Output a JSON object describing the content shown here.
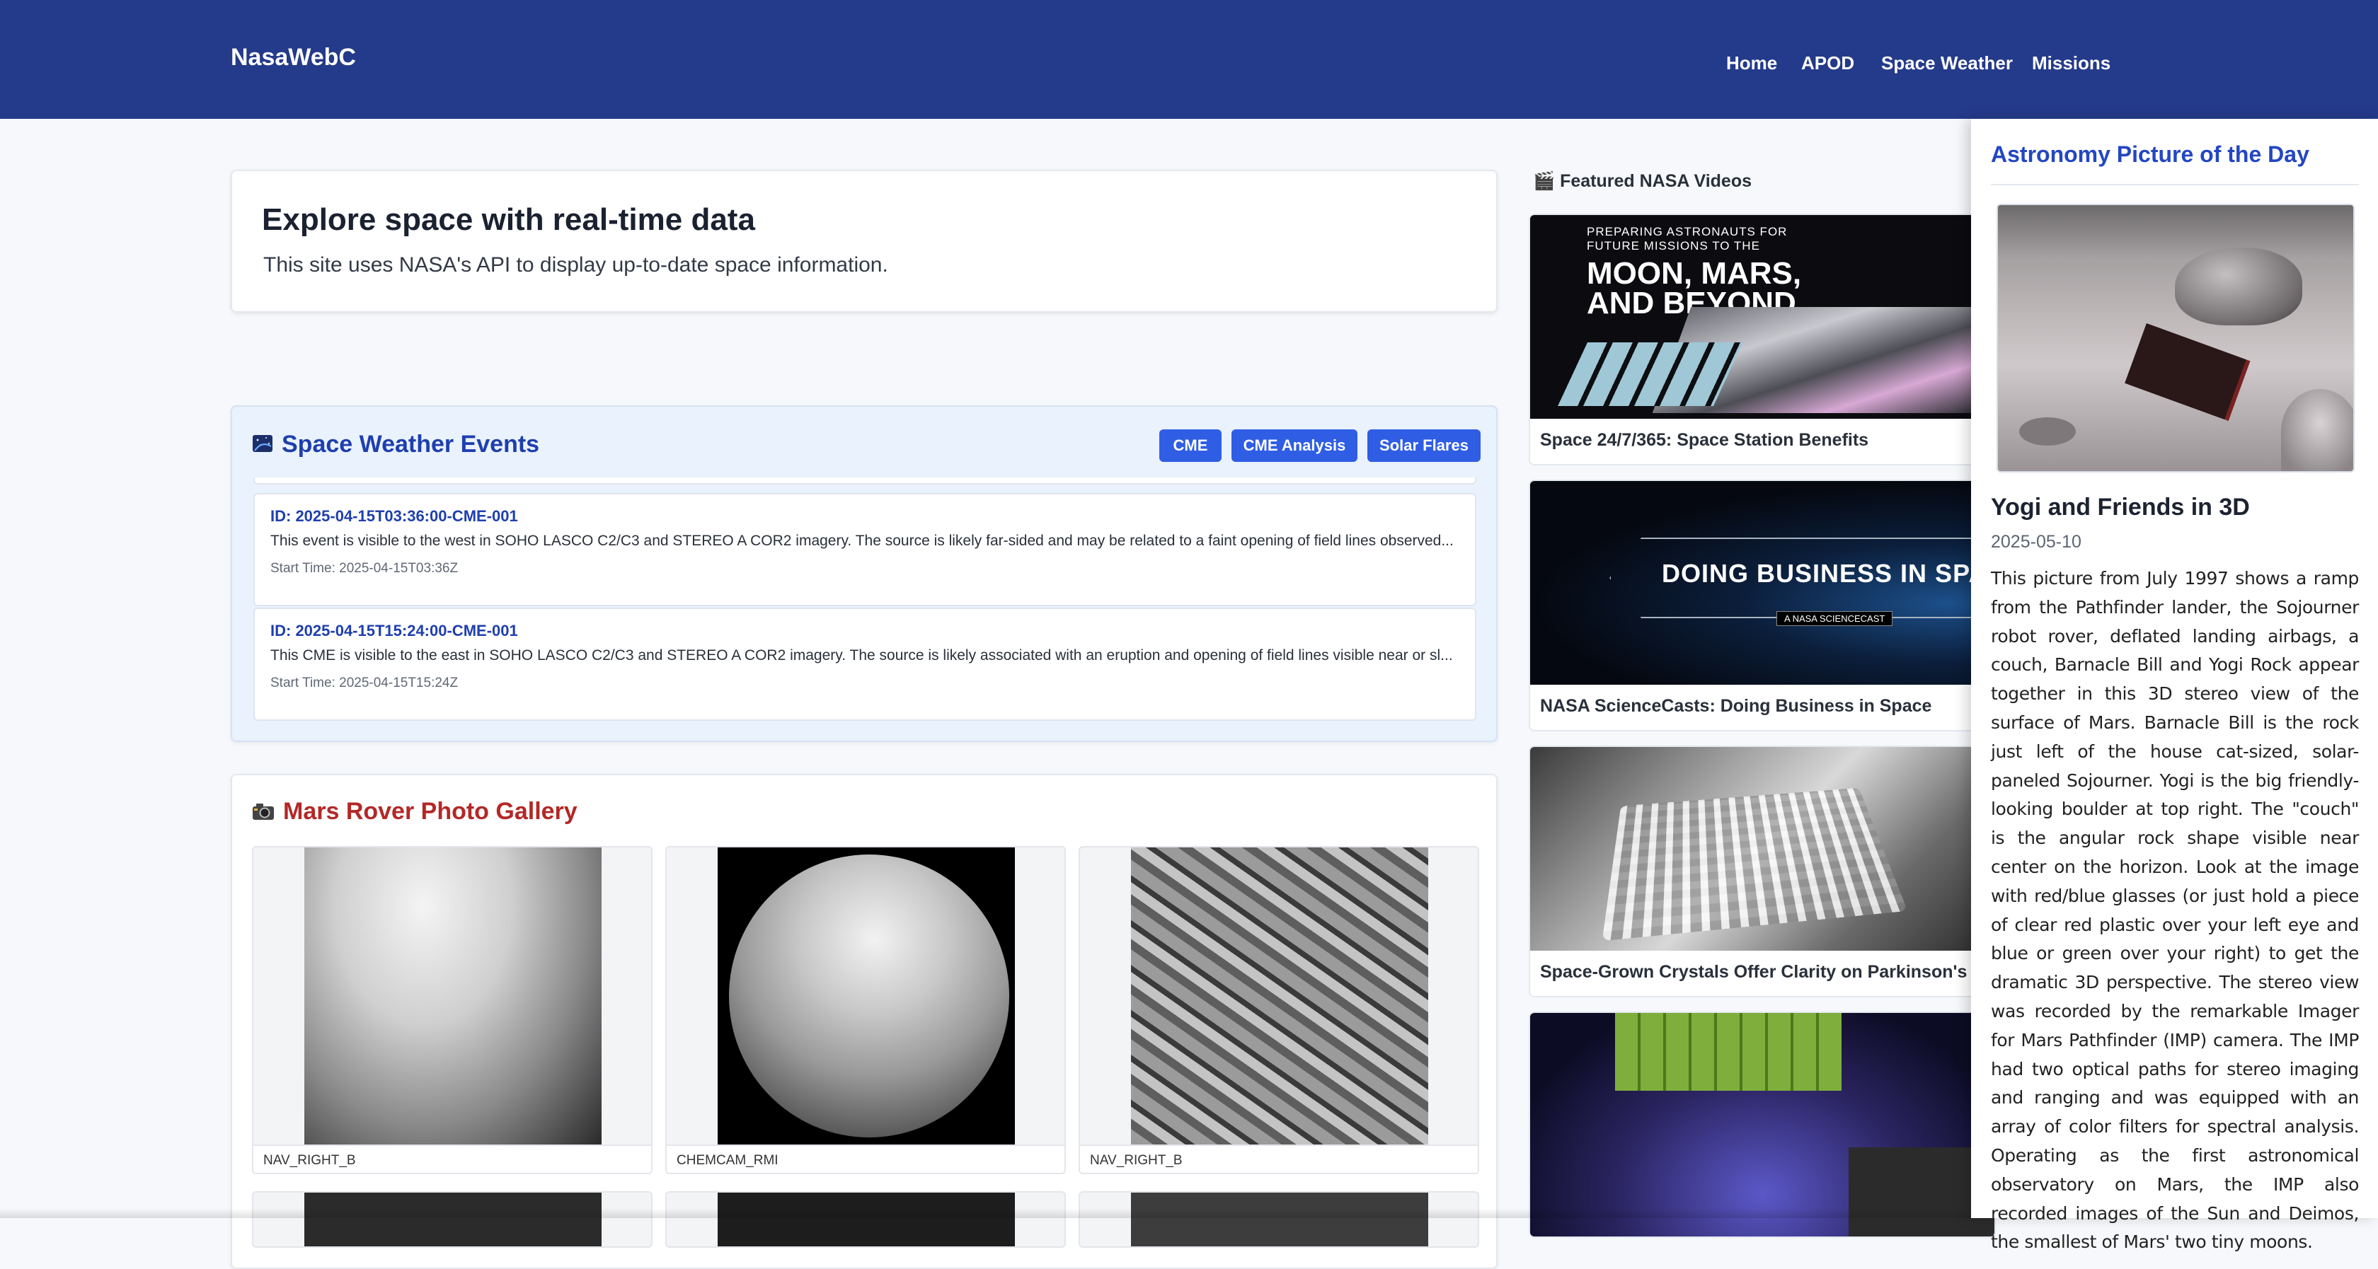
{
  "header": {
    "brand": "NasaWebC",
    "nav": [
      "Home",
      "APOD",
      "Space Weather",
      "Missions"
    ]
  },
  "intro": {
    "title": "Explore space with real-time data",
    "subtitle": "This site uses NASA's API to display up-to-date space information."
  },
  "weather": {
    "title": "Space Weather Events",
    "buttons": [
      "CME",
      "CME Analysis",
      "Solar Flares"
    ],
    "events": [
      {
        "id": "ID: 2025-04-15T03:36:00-CME-001",
        "description": "This event is visible to the west in SOHO LASCO C2/C3 and STEREO A COR2 imagery. The source is likely far-sided and may be related to a faint opening of field lines observed...",
        "start": "Start Time: 2025-04-15T03:36Z"
      },
      {
        "id": "ID: 2025-04-15T15:24:00-CME-001",
        "description": "This CME is visible to the east in SOHO LASCO C2/C3 and STEREO A COR2 imagery. The source is likely associated with an eruption and opening of field lines visible near or sl...",
        "start": "Start Time: 2025-04-15T15:24Z"
      }
    ]
  },
  "mars": {
    "title": "Mars Rover Photo Gallery",
    "photos": [
      {
        "camera": "NAV_RIGHT_B"
      },
      {
        "camera": "CHEMCAM_RMI"
      },
      {
        "camera": "NAV_RIGHT_B"
      }
    ]
  },
  "videos": {
    "title": "Featured NASA Videos",
    "items": [
      {
        "title": "Space 24/7/365: Space Station Benefits",
        "thumb_text": [
          "PREPARING ASTRONAUTS FOR",
          "FUTURE MISSIONS TO THE",
          "MOON, MARS,",
          "AND BEYOND"
        ]
      },
      {
        "title": "NASA ScienceCasts: Doing Business in Space",
        "thumb_text": [
          "DOING BUSINESS IN SPA",
          "A NASA SCIENCECAST"
        ]
      },
      {
        "title": "Space-Grown Crystals Offer Clarity on Parkinson's Dise",
        "thumb_text": []
      },
      {
        "title": "",
        "thumb_text": []
      }
    ]
  },
  "apod": {
    "heading": "Astronomy Picture of the Day",
    "title": "Yogi and Friends in 3D",
    "date": "2025-05-10",
    "explanation": "This picture from July 1997 shows a ramp from the Pathfinder lander, the Sojourner robot rover, deflated landing airbags, a couch, Barnacle Bill and Yogi Rock appear together in this 3D stereo view of the surface of Mars. Barnacle Bill is the rock just left of the house cat-sized, solar-paneled Sojourner. Yogi is the big friendly-looking boulder at top right. The \"couch\" is the angular rock shape visible near center on the horizon. Look at the image with red/blue glasses (or just hold a piece of clear red plastic over your left eye and blue or green over your right) to get the dramatic 3D perspective. The stereo view was recorded by the remarkable Imager for Mars Pathfinder (IMP) camera. The IMP had two optical paths for stereo imaging and ranging and was equipped with an array of color filters for spectral analysis. Operating as the first astronomical observatory on Mars, the IMP also recorded images of the Sun and Deimos, the smallest of Mars' two tiny moons."
  }
}
